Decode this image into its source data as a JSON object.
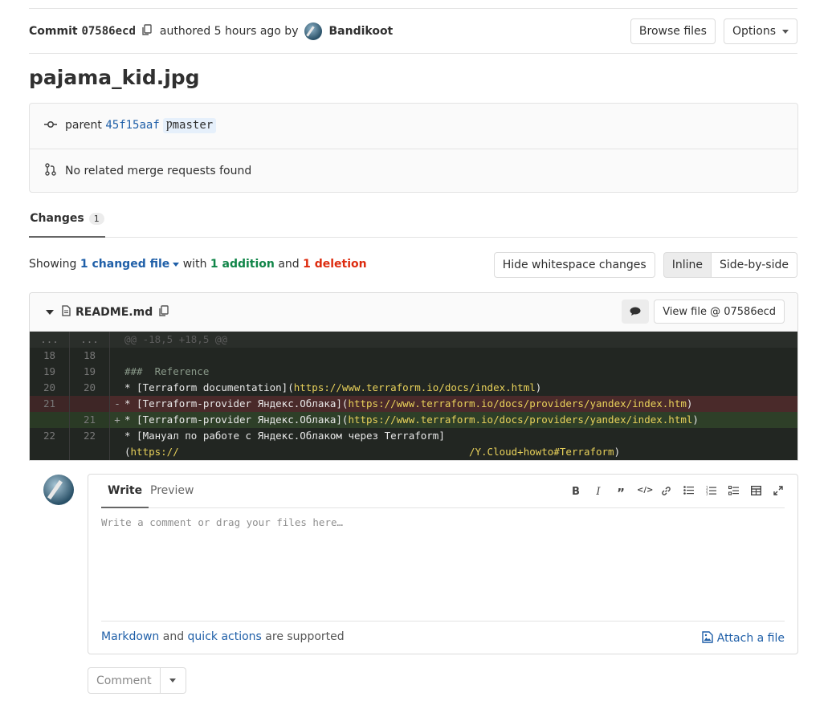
{
  "commit": {
    "label": "Commit",
    "sha": "07586ecd",
    "authored_text": "authored 5 hours ago by",
    "author": "Bandikoot",
    "browse_files": "Browse files",
    "options": "Options"
  },
  "title": "pajama_kid.jpg",
  "info": {
    "parent_label": "parent",
    "parent_sha": "45f15aaf",
    "branch": "master",
    "merge_requests": "No related merge requests found"
  },
  "tabs": {
    "changes_label": "Changes",
    "changes_count": "1"
  },
  "summary": {
    "showing": "Showing",
    "changed_file": "1 changed file",
    "with": "with",
    "addition": "1 addition",
    "and": "and",
    "deletion": "1 deletion"
  },
  "view_buttons": {
    "hide_whitespace": "Hide whitespace changes",
    "inline": "Inline",
    "side_by_side": "Side-by-side"
  },
  "file": {
    "name": "README.md",
    "view_file": "View file @ 07586ecd"
  },
  "diff_lines": [
    {
      "type": "meta",
      "old": "...",
      "new": "...",
      "sign": "",
      "text": "@@ -18,5 +18,5 @@"
    },
    {
      "type": "ctx",
      "old": "18",
      "new": "18",
      "sign": "",
      "text": ""
    },
    {
      "type": "ctx",
      "old": "19",
      "new": "19",
      "sign": "",
      "text": "###  Reference"
    },
    {
      "type": "ctx",
      "old": "20",
      "new": "20",
      "sign": "",
      "text": "* [Terraform documentation](",
      "url": "https://www.terraform.io/docs/index.html",
      "tail": ")"
    },
    {
      "type": "del",
      "old": "21",
      "new": "",
      "sign": "-",
      "text": "* [Terraform-provider Яндекс.Облака](",
      "url": "https://www.terraform.io/docs/providers/yandex/index.htm",
      "tail": ")"
    },
    {
      "type": "add",
      "old": "",
      "new": "21",
      "sign": "+",
      "text": "* [Terraform-provider Яндекс.Облака](",
      "url": "https://www.terraform.io/docs/providers/yandex/index.html",
      "tail": ")"
    },
    {
      "type": "ctx",
      "old": "22",
      "new": "22",
      "sign": "",
      "text": "* [Мануал по работе с Яндекс.Облаком через Terraform]"
    },
    {
      "type": "ctx",
      "old": "",
      "new": "",
      "sign": "",
      "text": "(",
      "url": "https://                                                /Y.Cloud+howto#Terraform",
      "tail": ")"
    }
  ],
  "comment": {
    "write_tab": "Write",
    "preview_tab": "Preview",
    "placeholder": "Write a comment or drag your files here…",
    "markdown": "Markdown",
    "and": "and",
    "quick_actions": "quick actions",
    "supported": "are supported",
    "attach": "Attach a file",
    "submit": "Comment"
  }
}
